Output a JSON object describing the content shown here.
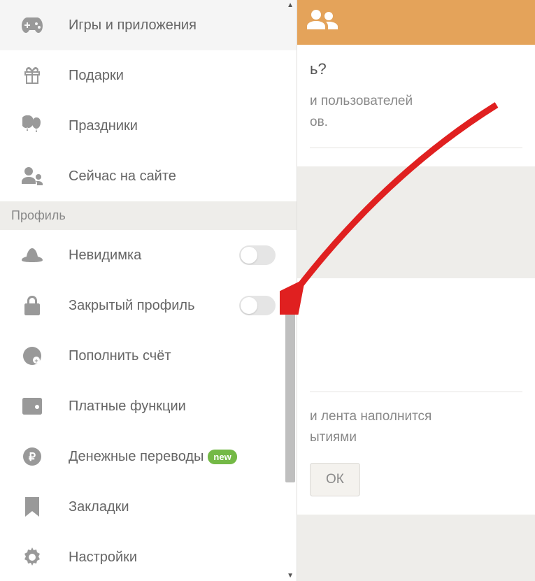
{
  "sidebar": {
    "sections": {
      "top": [
        {
          "icon": "gamepad",
          "label": "Игры и приложения"
        },
        {
          "icon": "gift",
          "label": "Подарки"
        },
        {
          "icon": "balloons",
          "label": "Праздники"
        },
        {
          "icon": "people",
          "label": "Сейчас на сайте"
        }
      ],
      "profile_header": "Профиль",
      "profile": [
        {
          "icon": "hat",
          "label": "Невидимка",
          "toggle": false
        },
        {
          "icon": "lock",
          "label": "Закрытый профиль",
          "toggle": false
        },
        {
          "icon": "coin",
          "label": "Пополнить счёт"
        },
        {
          "icon": "wallet",
          "label": "Платные функции"
        },
        {
          "icon": "ruble",
          "label": "Денежные переводы",
          "badge": "new"
        },
        {
          "icon": "bookmark",
          "label": "Закладки"
        },
        {
          "icon": "gear",
          "label": "Настройки"
        }
      ]
    }
  },
  "main": {
    "title_fragment": "ь?",
    "text1a": "и пользователей",
    "text1b": "ов.",
    "text2a": "и лента наполнится",
    "text2b": "ытиями",
    "ok_label": "ОК"
  },
  "badge": {
    "new": "new"
  }
}
